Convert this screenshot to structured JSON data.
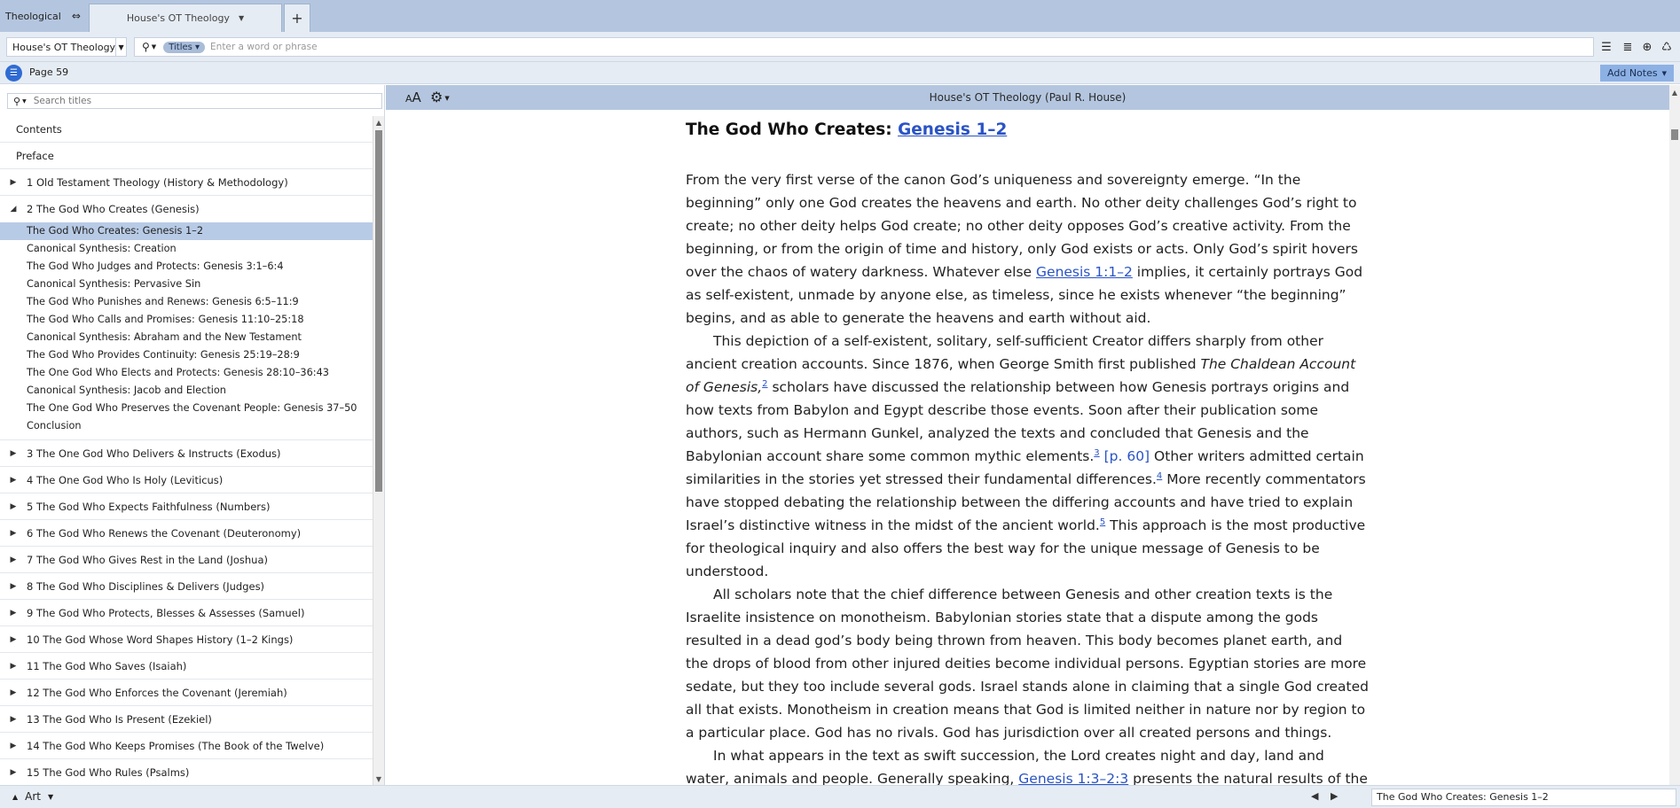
{
  "tabs": {
    "group_label": "Theological",
    "group_icon": "split-panes-icon",
    "active_label": "House's OT Theology"
  },
  "toolbar": {
    "resource": "House's OT Theology",
    "search_scope": "Titles",
    "search_placeholder": "Enter a word or phrase",
    "icons": [
      "lines-icon",
      "indent-list-icon",
      "add-circle-icon",
      "recycle-icon"
    ]
  },
  "pagebar": {
    "page": "Page 59",
    "add_notes": "Add Notes"
  },
  "sidebar": {
    "search_placeholder": "Search titles",
    "top_items": [
      "Contents",
      "Preface"
    ],
    "chapter1": "1 Old Testament Theology (History & Methodology)",
    "chapter2": "2 The God Who Creates (Genesis)",
    "chapter2_children": [
      "The God Who Creates: Genesis 1–2",
      "Canonical Synthesis: Creation",
      "The God Who Judges and Protects: Genesis 3:1–6:4",
      "Canonical Synthesis: Pervasive Sin",
      "The God Who Punishes and Renews: Genesis 6:5–11:9",
      "The God Who Calls and Promises: Genesis 11:10–25:18",
      "Canonical Synthesis: Abraham and the New Testament",
      "The God Who Provides Continuity: Genesis 25:19–28:9",
      "The One God Who Elects and Protects: Genesis 28:10–36:43",
      "Canonical Synthesis: Jacob and Election",
      "The One God Who Preserves the Covenant People: Genesis 37–50",
      "Conclusion"
    ],
    "chapters": [
      "3 The One God Who Delivers & Instructs (Exodus)",
      "4 The One God Who Is Holy (Leviticus)",
      "5 The God Who Expects Faithfulness (Numbers)",
      "6 The God Who Renews the Covenant (Deuteronomy)",
      "7 The God Who Gives Rest in the Land (Joshua)",
      "8 The God Who Disciplines & Delivers (Judges)",
      "9 The God Who Protects, Blesses & Assesses (Samuel)",
      "10 The God Whose Word Shapes History (1–2 Kings)",
      "11 The God Who Saves (Isaiah)",
      "12 The God Who Enforces the Covenant (Jeremiah)",
      "13 The God Who Is Present (Ezekiel)",
      "14 The God Who Keeps Promises (The Book of the Twelve)",
      "15 The God Who Rules (Psalms)"
    ]
  },
  "reader": {
    "header_title": "House's OT Theology (Paul R. House)",
    "heading_text": "The God Who Creates: ",
    "heading_link": "Genesis 1–2",
    "p1": {
      "a": "From the very first verse of the canon God’s uniqueness and sovereignty emerge. “In the beginning” only one God creates the heavens and earth. No other deity challenges God’s right to create; no other deity helps God create; no other deity opposes God’s creative activity. From the beginning, or from the origin of time and history, only God exists or acts. Only God’s spirit hovers over the chaos of watery darkness. Whatever else ",
      "link": "Genesis 1:1–2",
      "b": " implies, it certainly portrays God as self-existent, unmade by anyone else, as timeless, since he exists whenever “the beginning” begins, and as able to generate the heavens and earth without aid."
    },
    "p2": {
      "a": "This depiction of a self-existent, solitary, self-sufficient Creator differs sharply from other ancient creation accounts. Since 1876, when George Smith first published ",
      "italic": "The Chaldean Account of Genesis,",
      "fn2": "2",
      "b": " scholars have discussed the relationship between how Genesis portrays origins and how texts from Babylon and Egypt describe those events. Soon after their publication some authors, such as Hermann Gunkel, analyzed the texts and concluded that Genesis and the Babylonian account share some common mythic elements.",
      "fn3": "3",
      "page_ref": " [p. 60]",
      "c": " Other writers admitted certain similarities in the stories yet stressed their fundamental differences.",
      "fn4": "4",
      "d": " More recently commentators have stopped debating the relationship between the differing accounts and have tried to explain Israel’s distinctive witness in the midst of the ancient world.",
      "fn5": "5",
      "e": " This approach is the most productive for theological inquiry and also offers the best way for the unique message of Genesis to be understood."
    },
    "p3": "All scholars note that the chief difference between Genesis and other creation texts is the Israelite insistence on monotheism. Babylonian stories state that a dispute among the gods resulted in a dead god’s body being thrown from heaven. This body becomes planet earth, and the drops of blood from other injured deities become individual persons. Egyptian stories are more sedate, but they too include several gods. Israel stands alone in claiming that a single God created all that exists. Monotheism in creation means that God is limited neither in nature nor by region to a particular place. God has no rivals. God has jurisdiction over all created persons and things.",
    "p4": {
      "a": "In what appears in the text as swift succession, the Lord creates night and day, land and water, animals and people. Generally speaking, ",
      "link": "Genesis 1:3–2:3",
      "b": " presents the natural results of the preceding two verses. If only one God exists, then that God must be responsible for every creative act. Every created entity derives"
    }
  },
  "bottombar": {
    "panel_label": "Art",
    "location": "The God Who Creates: Genesis 1–2"
  },
  "colors": {
    "chrome": "#b4c6df",
    "toolbar": "#e6ecf4",
    "selection": "#b8cbe6",
    "link": "#2a53c5",
    "accent": "#2f6bd3"
  }
}
